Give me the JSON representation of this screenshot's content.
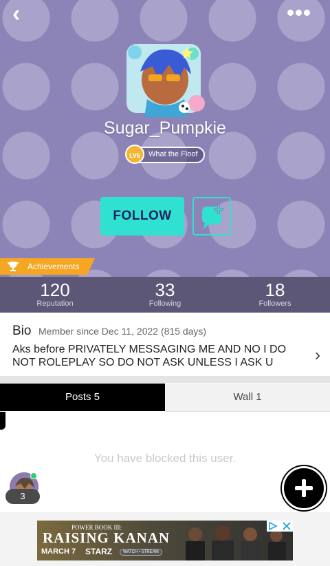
{
  "profile": {
    "username": "Sugar_Pumpkie",
    "level": "LV6",
    "level_title": "What the Floof"
  },
  "actions": {
    "follow_label": "FOLLOW"
  },
  "achievements": {
    "label": "Achievements"
  },
  "stats": [
    {
      "value": "120",
      "label": "Reputation"
    },
    {
      "value": "33",
      "label": "Following"
    },
    {
      "value": "18",
      "label": "Followers"
    }
  ],
  "bio": {
    "title": "Bio",
    "member_since": "Member since Dec 11, 2022 (815 days)",
    "text": "Aks before PRIVATELY MESSAGING ME AND NO I DO NOT ROLEPLAY SO DO NOT ASK UNLESS I ASK U"
  },
  "tabs": [
    {
      "label": "Posts 5"
    },
    {
      "label": "Wall 1"
    }
  ],
  "blocked_message": "You have blocked this user.",
  "online_count": "3",
  "ad": {
    "subtitle": "POWER BOOK III:",
    "title": "RAISING KANAN",
    "date": "MARCH 7",
    "network": "STARZ",
    "cta": "WATCH • STREAM"
  },
  "colors": {
    "hero_bg": "#8c84b6",
    "accent": "#30e0d0",
    "follow_text": "#1c2360",
    "achievement": "#f5a623",
    "stats_bar": "#5c5677"
  },
  "icons": [
    "back-icon",
    "more-icon",
    "chat-add-icon",
    "trophy-icon",
    "chevron-right-icon",
    "plus-icon",
    "ad-choices-icon"
  ]
}
